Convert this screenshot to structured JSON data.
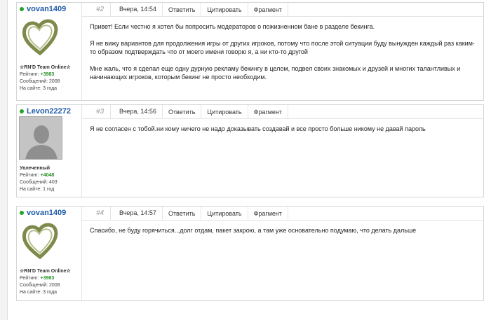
{
  "posts": [
    {
      "author": "vovan1409",
      "avatar": "heart-sculpture-avatar",
      "status_title": "☆RN'D Team Online☆",
      "rating_label": "Рейтинг:",
      "rating": "+3983",
      "messages": "Сообщений: 2008",
      "onsite": "На сайте: 3 года",
      "number": "#2",
      "date": "Вчера, 14:54",
      "reply": "Ответить",
      "quote": "Цитировать",
      "fragment": "Фрагмент",
      "paragraphs": [
        "Привет! Если честно я хотел бы попросить модераторов о пожизненном бане в разделе бекинга.",
        "Я не вижу вариантов для продолжения игры от других игроков, потому что после этой ситуации буду вынужден каждый раз каким-то образом подтверждать что от моего имени говорю я, а ни кто-то другой",
        "Мне жаль, что я сделал еще одну дурную рекламу бекингу в целом, подвел своих знакомых и друзей и многих талантливых и начинающих игроков, которым бекинг не просто необходим."
      ]
    },
    {
      "author": "Levon22272",
      "avatar": "default-user-avatar",
      "status_title": "Увлеченный",
      "rating_label": "Рейтинг:",
      "rating": "+4048",
      "messages": "Сообщений: 403",
      "onsite": "На сайте: 1 год",
      "number": "#3",
      "date": "Вчера, 14:56",
      "reply": "Ответить",
      "quote": "Цитировать",
      "fragment": "Фрагмент",
      "paragraphs": [
        "Я не согласен с тобой.ни кому ничего не надо доказывать создавай и все просто больше никому не давай пароль"
      ]
    },
    {
      "author": "vovan1409",
      "avatar": "heart-sculpture-avatar",
      "status_title": "☆RN'D Team Online☆",
      "rating_label": "Рейтинг:",
      "rating": "+3983",
      "messages": "Сообщений: 2008",
      "onsite": "На сайте: 3 года",
      "number": "#4",
      "date": "Вчера, 14:57",
      "reply": "Ответить",
      "quote": "Цитировать",
      "fragment": "Фрагмент",
      "paragraphs": [
        "Спасибо, не буду горячиться...долг отдам, пакет закрою, а там уже основательно подумаю, что делать дальше"
      ]
    }
  ],
  "colors": {
    "username": "#1e5aa8",
    "online_dot": "#22a52a",
    "rating": "#2b8f2b"
  }
}
